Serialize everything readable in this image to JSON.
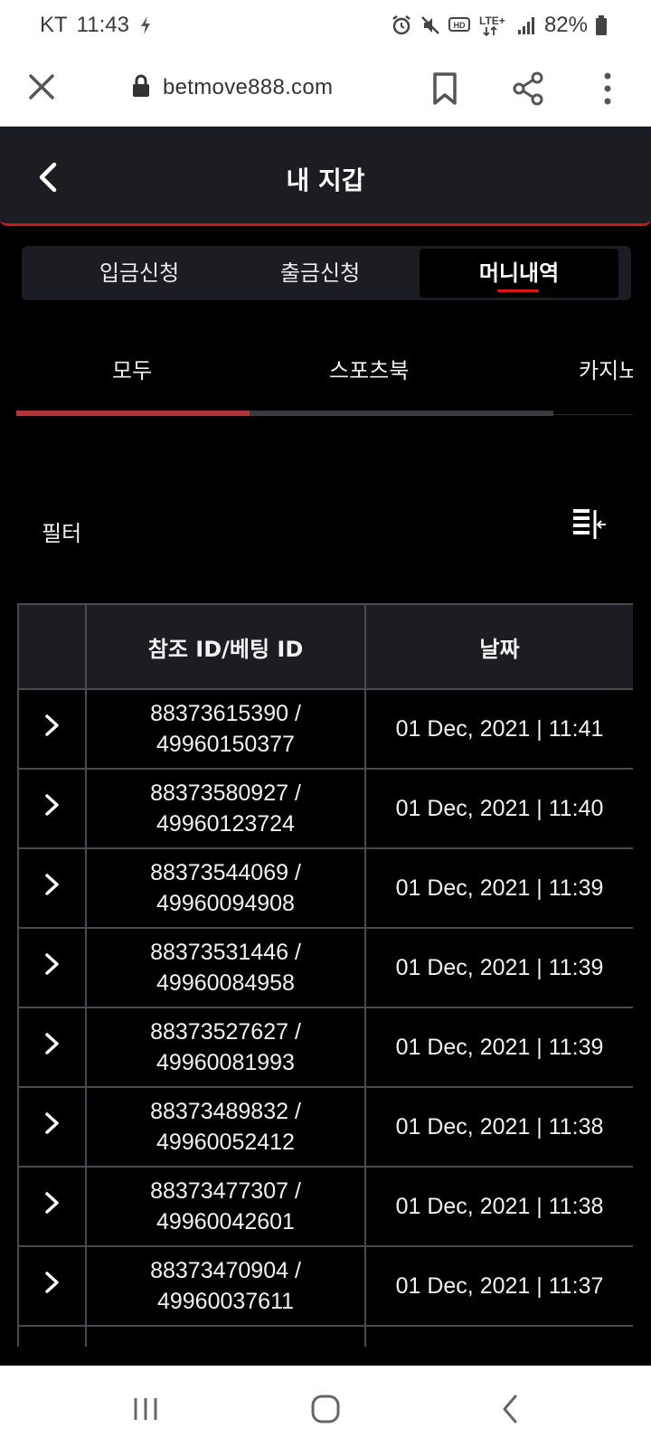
{
  "status_bar": {
    "carrier": "KT",
    "time": "11:43",
    "network": "LTE+",
    "hd": "HD",
    "battery": "82%"
  },
  "browser": {
    "url": "betmove888.com"
  },
  "header": {
    "title": "내 지갑"
  },
  "wallet_tabs": [
    {
      "label": "입금신청"
    },
    {
      "label": "출금신청"
    },
    {
      "label": "머니내역"
    }
  ],
  "sub_tabs": [
    {
      "label": "모두"
    },
    {
      "label": "스포츠북"
    },
    {
      "label": "카지노"
    }
  ],
  "filter": {
    "label": "필터"
  },
  "table": {
    "headers": [
      "",
      "참조 ID/베팅 ID",
      "날짜"
    ],
    "rows": [
      {
        "ref": "88373615390 /",
        "bet": "49960150377",
        "date": "01 Dec, 2021 | 11:41"
      },
      {
        "ref": "88373580927 /",
        "bet": "49960123724",
        "date": "01 Dec, 2021 | 11:40"
      },
      {
        "ref": "88373544069 /",
        "bet": "49960094908",
        "date": "01 Dec, 2021 | 11:39"
      },
      {
        "ref": "88373531446 /",
        "bet": "49960084958",
        "date": "01 Dec, 2021 | 11:39"
      },
      {
        "ref": "88373527627 /",
        "bet": "49960081993",
        "date": "01 Dec, 2021 | 11:39"
      },
      {
        "ref": "88373489832 /",
        "bet": "49960052412",
        "date": "01 Dec, 2021 | 11:38"
      },
      {
        "ref": "88373477307 /",
        "bet": "49960042601",
        "date": "01 Dec, 2021 | 11:38"
      },
      {
        "ref": "88373470904 /",
        "bet": "49960037611",
        "date": "01 Dec, 2021 | 11:37"
      }
    ]
  },
  "colors": {
    "accent_red": "#d9151b",
    "header_bg": "#1c1d22",
    "border": "#4a4b50"
  }
}
